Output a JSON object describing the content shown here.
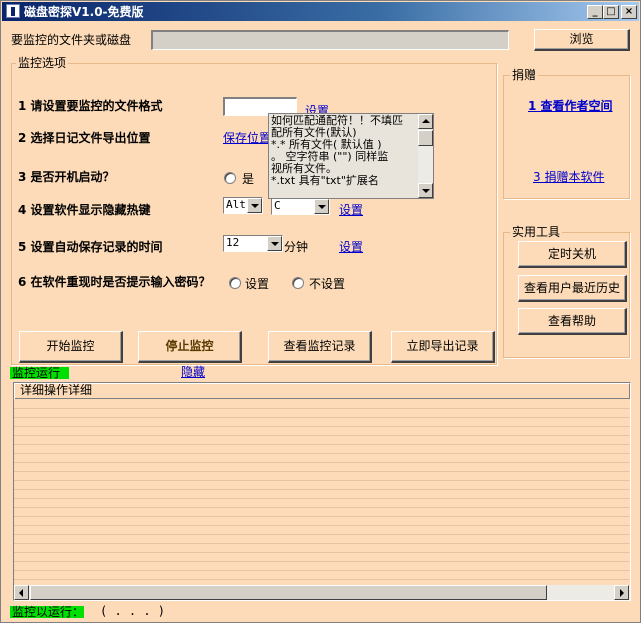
{
  "window": {
    "title": "磁盘密探V1.0-免费版",
    "min_icon": "minimize-icon",
    "max_icon": "maximize-icon",
    "close_icon": "close-icon"
  },
  "top": {
    "folder_label": "要监控的文件夹或磁盘",
    "folder_value": "",
    "browse_label": "浏览"
  },
  "monitor_options": {
    "group_label": "监控选项",
    "q1_label": "1 请设置要监控的文件格式",
    "q1_value": "",
    "q1_link": "设置",
    "q2_label": "2 选择日记文件导出位置",
    "q2_link": "保存位置",
    "q3_label": "3 是否开机启动？",
    "q3_yes": "是",
    "q4_label": "4 设置软件显示隐藏热键",
    "q4_modifier": "Alt",
    "q4_key": "C",
    "q4_link": "设置",
    "q5_label": "5 设置自动保存记录的时间",
    "q5_value": "12",
    "q5_unit": "分钟",
    "q5_link": "设置",
    "q6_label": "6 在软件重现时是否提示输入密码？",
    "q6_opt1": "设置",
    "q6_opt2": "不设置"
  },
  "tooltip": {
    "line1": "如何匹配通配符！！不填匹",
    "line2": "配所有文件(默认)",
    "line3": "*.*  所有文件( 默认值 )",
    "line4": "。 空字符串 (\"\") 同样监",
    "line5": "视所有文件。",
    "line6": "*.txt  具有\"txt\"扩展名"
  },
  "donate": {
    "group_label": "捐赠",
    "link1": "1  查看作者空间",
    "link3": "3  捐赠本软件"
  },
  "tools": {
    "group_label": "实用工具",
    "btn1": "定时关机",
    "btn2": "查看用户最近历史",
    "btn3": "查看帮助"
  },
  "actions": {
    "start": "开始监控",
    "stop": "停止监控",
    "view": "查看监控记录",
    "export": "立即导出记录"
  },
  "status": {
    "running": "监控运行",
    "hide_link": "隐藏",
    "bottom": "监控以运行：",
    "bottom_value": "( . . . )"
  },
  "list": {
    "column": "详细操作详细"
  }
}
